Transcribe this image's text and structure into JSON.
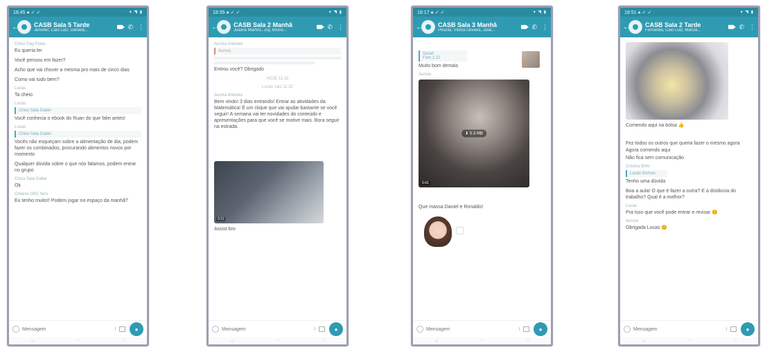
{
  "phones": [
    {
      "status_time": "18:45 ● ✓ ✓",
      "status_icons": "▾ ◥ ▮",
      "group_title": "CASB Sala 5 Tarde",
      "group_sub": "Jennifer, Caio Luiz, Daniela...",
      "messages": [
        {
          "sender": "Chico Gay Fotas",
          "text": "Eu queria ler"
        },
        {
          "text": "Você pensou em fazer?"
        },
        {
          "text": "Acho que vai chover a mesma pro mais de cinco dias"
        },
        {
          "text": "Como vai tudo bem?"
        },
        {
          "sender": "Lucas",
          "text": "Ta cheio"
        },
        {
          "sender": "Lucas",
          "quote": "Chico Sala Gabei",
          "text": "Você conhecia o ebook do Ruan do que falei antes!"
        },
        {
          "sender": "Lucas",
          "quote": "Chico Sala Gabei",
          "text": "Vocês não esqueçam sobre a alimentação de dia, podem fazer os combinados, procurando alimentos novos por momento"
        },
        {
          "text": "Qualquer dúvida sobre o que nós falamos, podem entrar no grupo"
        },
        {
          "sender": "Chico Sala Gabei",
          "text": "Ok"
        },
        {
          "sender": "Cheese OKC fans",
          "text": "Eu tenho muito!! Podem jogar no espaço da manhã?"
        }
      ],
      "composer_placeholder": "Mensagem"
    },
    {
      "status_time": "18:35 ● ✓ ✓",
      "status_icons": "▾ ◥ ▮",
      "group_title": "CASB Sala 2 Manhã",
      "group_sub": "Juliana Martins, Joy, Bruno...",
      "messages": [
        {
          "sender": "Aurora Antunes",
          "quote": "Aurora",
          "text": ""
        },
        {
          "text": "Entrou você? Obrigado"
        },
        {
          "center": "HOJE 11:32"
        },
        {
          "center": "Lucas saiu 11:32"
        },
        {
          "sender": "Aurora Antunes",
          "text": "Bem vindo! 3 dias entrando! Entrar as atividades da Matemática! É um clique que vai ajudar bastante se você seguir! A semana vai ter novidades do conteúdo e apresentações para que você se motive mais. Bora seguir na estrada."
        }
      ],
      "video_length": "0:11",
      "caption": "Assist bro",
      "composer_placeholder": "Mensagem"
    },
    {
      "status_time": "18:17 ● ✓ ✓",
      "status_icons": "▾ ◥ ▮",
      "group_title": "CASB Sala 3 Manhã",
      "group_sub": "Priscila, Vitória Oliveira, Júlia...",
      "quote_sender": "Sarah",
      "quote_text": "Foto 1:22",
      "reply_text": "Muito bom demais",
      "video_sender": "Aurora",
      "video_size": "5.3 MB",
      "video_length": "0:41",
      "caption": "Que massa Daniel e Ronaldo!",
      "composer_placeholder": "Mensagem"
    },
    {
      "status_time": "18:51 ● ✓ ✓",
      "status_icons": "▾ ◥ ▮",
      "group_title": "CASB Sala 2 Tarde",
      "group_sub": "Fernanda, Caio Luiz, Márcia...",
      "messages": [
        {
          "text": "Comendo aqui na bolsa 👍"
        },
        {
          "text": "Fez todos os outros que queria fazer o mesmo agora"
        },
        {
          "text": "Agora comendo aqui"
        },
        {
          "text": "Não fica sem comunicação"
        },
        {
          "sender": "Cristina Brito",
          "quote": "Lucas Gomes",
          "text": "Tenho uma dúvida"
        },
        {
          "text": "Boa a aula! O que é fazer a outra? E a distância do trabalho? Qual é a melhor?"
        },
        {
          "sender": "Lucas",
          "text": "Pra isso que você pode entrar e revisar 😊"
        },
        {
          "sender": "Aurora",
          "text": "Obrigada Lucas 😊"
        }
      ],
      "composer_placeholder": "Mensagem"
    }
  ]
}
